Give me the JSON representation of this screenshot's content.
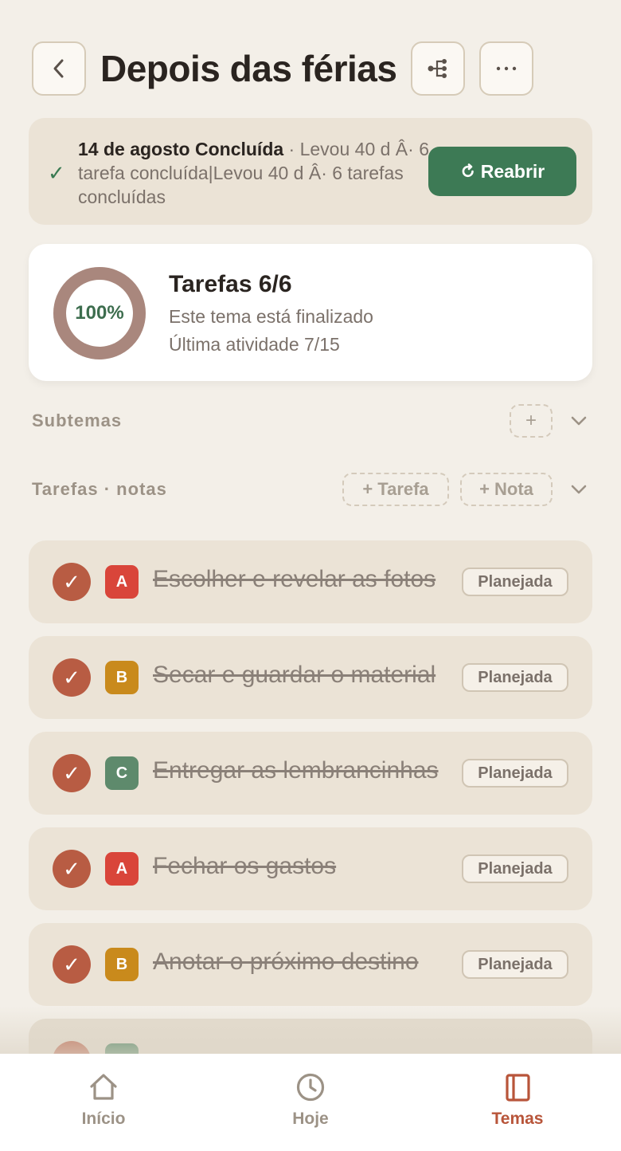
{
  "header": {
    "title": "Depois das férias",
    "back_icon": "chevron-left-icon",
    "tree_icon": "hierarchy-icon",
    "more_icon": "ellipsis-icon"
  },
  "banner": {
    "date_status": "14 de agosto Concluída",
    "detail": " · Levou 40 d Â· 6 tarefa concluída|Levou 40 d Â· 6 tarefas concluídas",
    "reopen_label": "Reabrir",
    "accent": "#3d7a55"
  },
  "progress": {
    "percent_label": "100%",
    "percent": 100,
    "title": "Tarefas 6/6",
    "subtitle": "Este tema está finalizado",
    "last_activity": "Última atividade 7/15"
  },
  "subthemes": {
    "label": "Subtemas",
    "add_label": "+"
  },
  "tasks_section": {
    "label": "Tarefas · notas",
    "add_task_label": "+ Tarefa",
    "add_note_label": "+ Nota"
  },
  "tasks": [
    {
      "priority": "A",
      "priority_color": "#d9453a",
      "text": "Escolher e revelar as fotos",
      "status": "Planejada"
    },
    {
      "priority": "B",
      "priority_color": "#c98a1c",
      "text": "Secar e guardar o material",
      "status": "Planejada"
    },
    {
      "priority": "C",
      "priority_color": "#5e8a6c",
      "text": "Entregar as lembrancinhas",
      "status": "Planejada"
    },
    {
      "priority": "A",
      "priority_color": "#d9453a",
      "text": "Fechar os gastos",
      "status": "Planejada"
    },
    {
      "priority": "B",
      "priority_color": "#c98a1c",
      "text": "Anotar o próximo destino",
      "status": "Planejada"
    }
  ],
  "tabbar": {
    "home": "Início",
    "today": "Hoje",
    "themes": "Temas",
    "active_color": "#b8553a"
  }
}
